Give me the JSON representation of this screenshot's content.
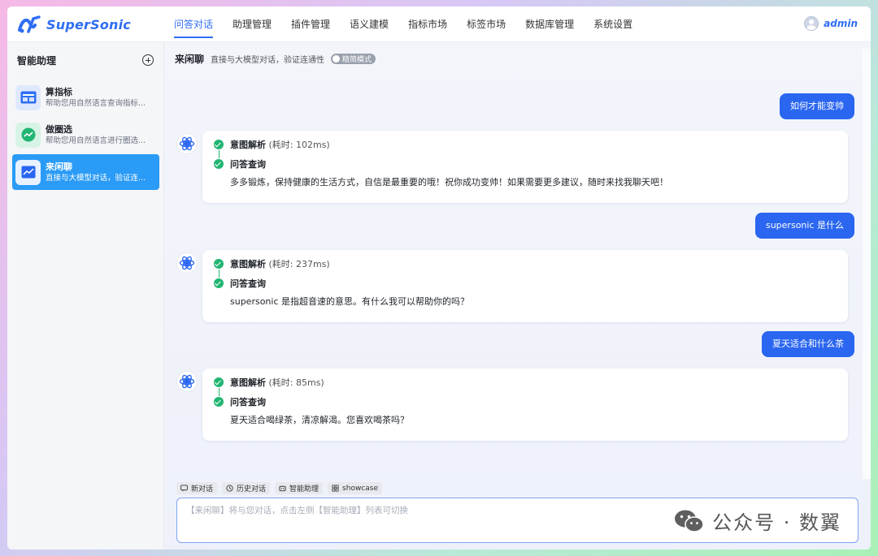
{
  "app": {
    "name": "SuperSonic",
    "accent": "#2f6ef3"
  },
  "nav": {
    "items": [
      {
        "label": "问答对话",
        "active": true
      },
      {
        "label": "助理管理"
      },
      {
        "label": "插件管理"
      },
      {
        "label": "语义建模"
      },
      {
        "label": "指标市场"
      },
      {
        "label": "标签市场"
      },
      {
        "label": "数据库管理"
      },
      {
        "label": "系统设置"
      }
    ]
  },
  "user": {
    "name": "admin"
  },
  "sidebar": {
    "title": "智能助理",
    "agents": [
      {
        "name": "算指标",
        "desc": "帮助您用自然语言查询指标...",
        "icon": "table-chart-icon",
        "color": "#2f6ef3"
      },
      {
        "name": "做圈选",
        "desc": "帮助您用自然语言进行圈选...",
        "icon": "trend-icon",
        "color": "#22b573"
      },
      {
        "name": "来闲聊",
        "desc": "直接与大模型对话，验证连...",
        "icon": "screen-chart-icon",
        "color": "#2a66f0",
        "active": true
      }
    ]
  },
  "topbar": {
    "title": "来闲聊",
    "desc": "直接与大模型对话，验证连通性",
    "toggle_label": "精简模式"
  },
  "messages": [
    {
      "question": "如何才能变帅",
      "steps": {
        "intent": "意图解析",
        "intent_time": "(耗时: 102ms)",
        "qa": "问答查询"
      },
      "answer": "多多锻炼，保持健康的生活方式，自信是最重要的哦！祝你成功变帅！如果需要更多建议，随时来找我聊天吧！"
    },
    {
      "question": "supersonic 是什么",
      "steps": {
        "intent": "意图解析",
        "intent_time": "(耗时: 237ms)",
        "qa": "问答查询"
      },
      "answer": "supersonic 是指超音速的意思。有什么我可以帮助你的吗？"
    },
    {
      "question": "夏天适合和什么茶",
      "steps": {
        "intent": "意图解析",
        "intent_time": "(耗时: 85ms)",
        "qa": "问答查询"
      },
      "answer": "夏天适合喝绿茶，清凉解渴。您喜欢喝茶吗？"
    }
  ],
  "quick_actions": [
    {
      "label": "新对话",
      "icon": "chat-icon"
    },
    {
      "label": "历史对话",
      "icon": "history-icon"
    },
    {
      "label": "智能助理",
      "icon": "robot-icon"
    },
    {
      "label": "showcase",
      "icon": "grid-icon"
    }
  ],
  "input": {
    "placeholder": "【来闲聊】将与您对话，点击左侧【智能助理】列表可切换"
  },
  "watermark": {
    "text": "公众号 · 数翼"
  }
}
